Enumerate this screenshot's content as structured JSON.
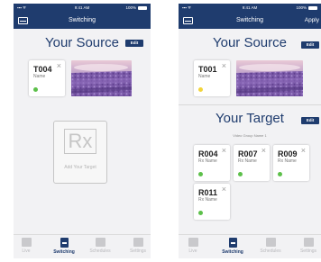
{
  "colors": {
    "brand": "#1f3c6e",
    "online": "#5cc04a",
    "warning": "#f2d43a"
  },
  "screen1": {
    "status": {
      "time": "9:41 AM",
      "battery": "100%"
    },
    "nav": {
      "title": "Switching"
    },
    "source": {
      "title": "Your Source",
      "edit_label": "Edit",
      "card": {
        "id": "T004",
        "name": "Name",
        "status": "online"
      }
    },
    "add_target": {
      "glyph": "Rx",
      "label": "Add Your Target"
    },
    "tabs": [
      {
        "label": "Live",
        "icon": "live-icon"
      },
      {
        "label": "Switching",
        "icon": "switching-icon",
        "active": true
      },
      {
        "label": "Schedules",
        "icon": "schedules-icon"
      },
      {
        "label": "Settings",
        "icon": "settings-icon"
      }
    ]
  },
  "screen2": {
    "status": {
      "time": "9:41 AM",
      "battery": "100%"
    },
    "nav": {
      "title": "Switching",
      "action": "Apply"
    },
    "source": {
      "title": "Your Source",
      "edit_label": "Edit",
      "card": {
        "id": "T001",
        "name": "Name",
        "status": "warning"
      }
    },
    "target": {
      "title": "Your Target",
      "edit_label": "Edit",
      "group": "Video Group Name 1",
      "cards": [
        {
          "id": "R004",
          "name": "Rx Name",
          "status": "online"
        },
        {
          "id": "R007",
          "name": "Rx Name",
          "status": "online"
        },
        {
          "id": "R009",
          "name": "Rx Name",
          "status": "online"
        },
        {
          "id": "R011",
          "name": "Rx Name",
          "status": "online"
        }
      ]
    },
    "tabs": [
      {
        "label": "Live",
        "icon": "live-icon"
      },
      {
        "label": "Switching",
        "icon": "switching-icon",
        "active": true
      },
      {
        "label": "Schedules",
        "icon": "schedules-icon"
      },
      {
        "label": "Settings",
        "icon": "settings-icon"
      }
    ]
  }
}
